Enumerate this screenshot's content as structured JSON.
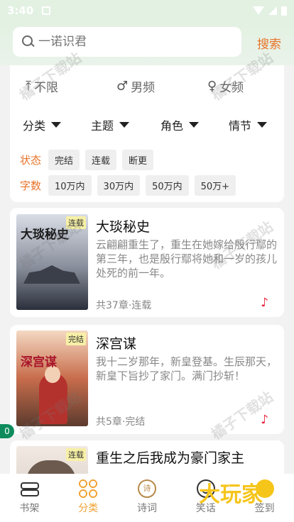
{
  "status_bar": {
    "time": "3:40"
  },
  "search": {
    "placeholder": "一诺识君",
    "button_label": "搜索"
  },
  "filters": {
    "gender": [
      "不限",
      "男频",
      "女频"
    ],
    "sort": [
      "分类",
      "主题",
      "角色",
      "情节"
    ],
    "status_label": "状态",
    "status_options": [
      "完结",
      "连载",
      "断更"
    ],
    "word_label": "字数",
    "word_options": [
      "10万内",
      "30万内",
      "50万内",
      "50万+"
    ]
  },
  "books": [
    {
      "title": "大琰秘史",
      "badge": "连载",
      "cover_title": "大琰秘史",
      "description": "云翩翩重生了，重生在她嫁给殷行鄢的第三年，也是殷行鄢将她和一岁的孩儿处死的前一年。",
      "meta": "共37章·连载"
    },
    {
      "title": "深宫谋",
      "badge": "完结",
      "cover_title": "深宫谋",
      "description": "我十二岁那年，新皇登基。生辰那天，新皇下旨抄了家门。满门抄斩！",
      "meta": "共5章·完结"
    },
    {
      "title": "重生之后我成为豪门家主",
      "badge": "连载",
      "cover_title": "",
      "description": "",
      "meta": ""
    }
  ],
  "floating_badge": "0",
  "bottom_nav": [
    {
      "label": "书架",
      "icon": "bookshelf-icon"
    },
    {
      "label": "分类",
      "icon": "category-icon"
    },
    {
      "label": "诗词",
      "icon": "poem-icon",
      "icon_text": "诗"
    },
    {
      "label": "笑话",
      "icon": "joke-icon"
    },
    {
      "label": "签到",
      "icon": "signin-icon"
    }
  ],
  "watermark": "橘子下载站",
  "logo_text": "大玩家",
  "colors": {
    "accent": "#e8742a",
    "nav_active": "#f0a030",
    "tiktok": "#e8223a"
  }
}
